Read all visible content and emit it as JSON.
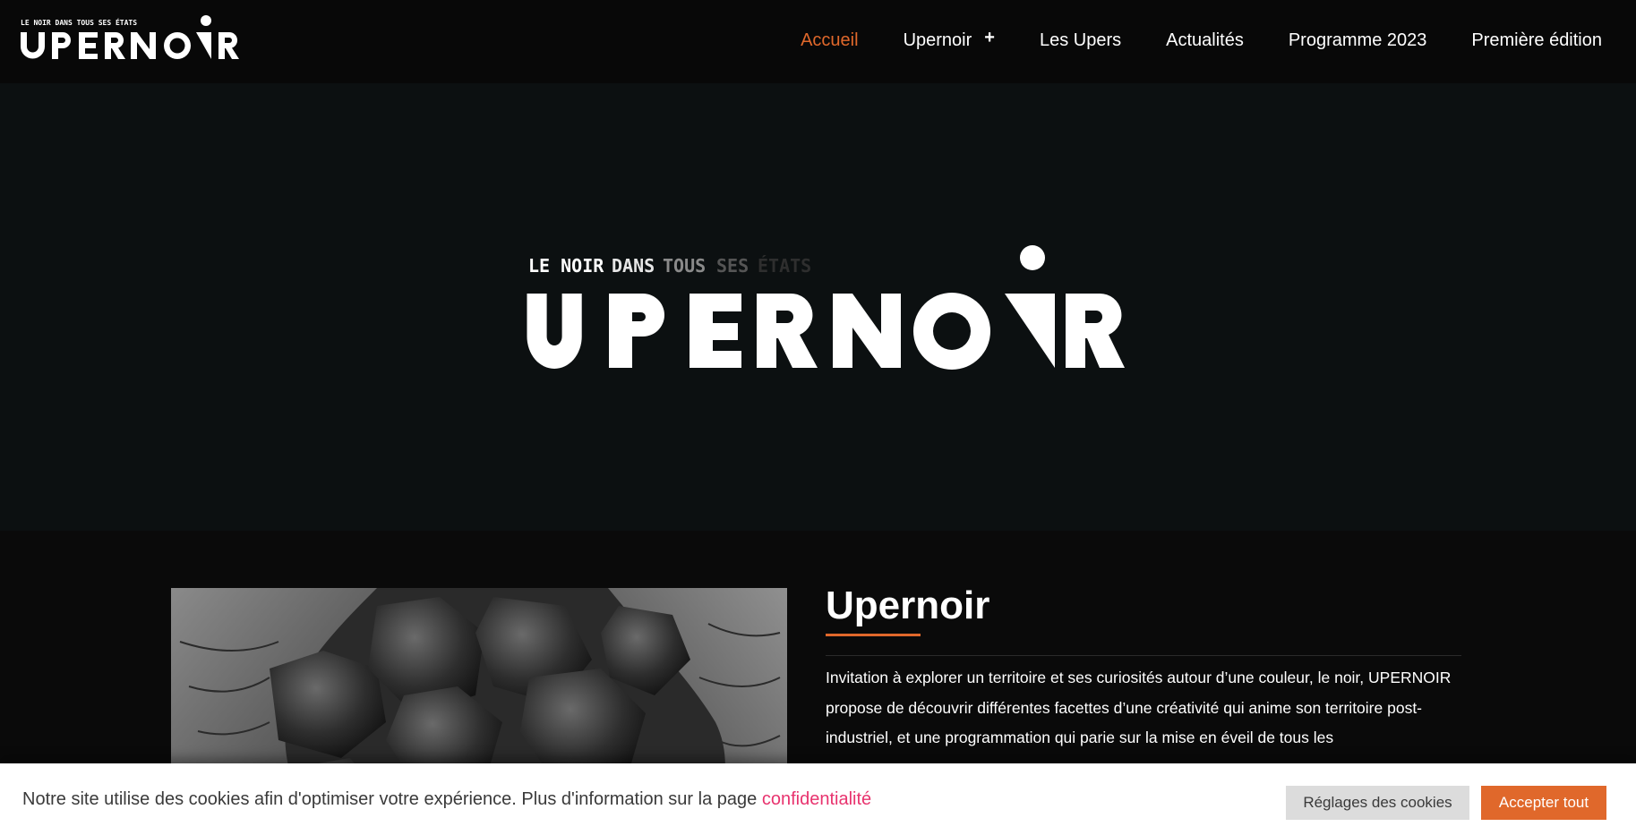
{
  "header": {
    "logo": {
      "tagline": "LE NOIR DANS TOUS SES ÉTATS",
      "wordmark": "UPERNOIR"
    },
    "nav": [
      {
        "label": "Accueil",
        "active": true
      },
      {
        "label": "Upernoir",
        "has_submenu": true,
        "submenu_icon": "+"
      },
      {
        "label": "Les Upers"
      },
      {
        "label": "Actualités"
      },
      {
        "label": "Programme 2023"
      },
      {
        "label": "Première édition"
      }
    ]
  },
  "hero": {
    "tagline_parts": [
      "LE NOIR",
      "DANS",
      "TOUS",
      "SES",
      "ÉTATS"
    ],
    "wordmark": "UPERNOIR"
  },
  "about": {
    "title": "Upernoir",
    "text": "Invitation à explorer un territoire et ses curiosités autour d’une couleur, le noir, UPERNOIR propose de découvrir différentes facettes d’une créativité qui anime son territoire post-industriel, et une programmation qui parie sur la mise en éveil de tous les"
  },
  "cookie": {
    "message": "Notre site utilise des cookies afin d'optimiser votre expérience. Plus d'information sur la page ",
    "link_label": "confidentialité",
    "settings_label": "Réglages des cookies",
    "accept_label": "Accepter tout"
  },
  "colors": {
    "accent": "#e0682b",
    "link": "#e8336e",
    "header_bg": "#080808",
    "hero_bg": "#0c1011"
  }
}
